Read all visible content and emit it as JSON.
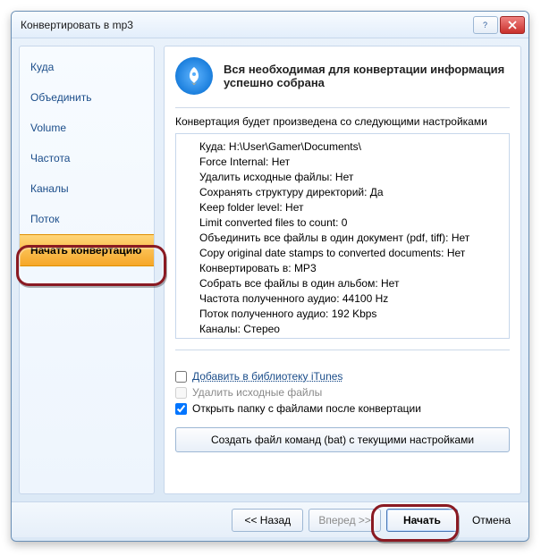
{
  "window": {
    "title": "Конвертировать в mp3"
  },
  "sidebar": {
    "items": [
      {
        "label": "Куда"
      },
      {
        "label": "Объединить"
      },
      {
        "label": "Volume"
      },
      {
        "label": "Частота"
      },
      {
        "label": "Каналы"
      },
      {
        "label": "Поток"
      },
      {
        "label": "Начать конвертацию"
      }
    ]
  },
  "main": {
    "header": "Вся необходимая для конвертации информация успешно собрана",
    "subheader": "Конвертация будет произведена со следующими настройками",
    "settings": [
      "Куда: H:\\User\\Gamer\\Documents\\",
      "Force Internal: Нет",
      "Удалить исходные файлы: Нет",
      "Сохранять структуру директорий: Да",
      "Keep folder level: Нет",
      "Limit converted files to count: 0",
      "Объединить все файлы в один документ (pdf, tiff): Нет",
      "Copy original date stamps to converted documents: Нет",
      "Конвертировать в: MP3",
      "Собрать все файлы в один альбом: Нет",
      "Частота полученного аудио: 44100 Hz",
      "Поток полученного аудио: 192 Kbps",
      "Каналы: Стерео"
    ],
    "checks": {
      "itunes": {
        "label": "Добавить в библиотеку iTunes",
        "checked": false,
        "link": true
      },
      "delete": {
        "label": "Удалить исходные файлы",
        "checked": false,
        "disabled": true
      },
      "open": {
        "label": "Открыть папку с файлами после конвертации",
        "checked": true
      }
    },
    "bat_button": "Создать файл команд (bat) с текущими настройками"
  },
  "footer": {
    "back": "<< Назад",
    "forward": "Вперед >>",
    "start": "Начать",
    "cancel": "Отмена"
  }
}
